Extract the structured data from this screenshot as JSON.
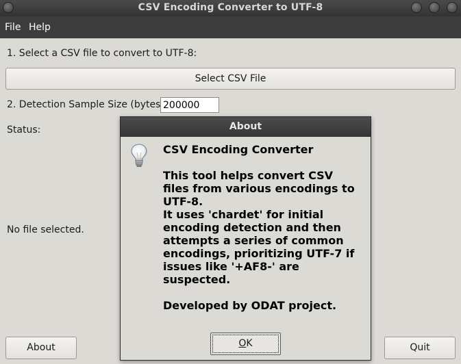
{
  "window": {
    "title": "CSV Encoding Converter to UTF-8"
  },
  "menu": {
    "file": "File",
    "help": "Help"
  },
  "main": {
    "step1_label": "1. Select a CSV file to convert to UTF-8:",
    "select_button": "Select CSV File",
    "step2_label": "2. Detection Sample Size (bytes):",
    "sample_size_value": "200000",
    "status_label": "Status:",
    "file_status": "No file selected.",
    "about_button": "About",
    "quit_button": "Quit"
  },
  "dialog": {
    "title": "About",
    "heading": "CSV Encoding Converter",
    "body": "This tool helps convert CSV\nfiles from various encodings to\nUTF-8.\nIt uses 'chardet' for initial\nencoding detection and then\nattempts a series of common\nencodings, prioritizing UTF-7 if\nissues like '+AF8-' are\nsuspected.",
    "footer": "Developed by ODAT project.",
    "ok_mnemonic": "O",
    "ok_rest": "K",
    "icon": "lightbulb-icon"
  }
}
